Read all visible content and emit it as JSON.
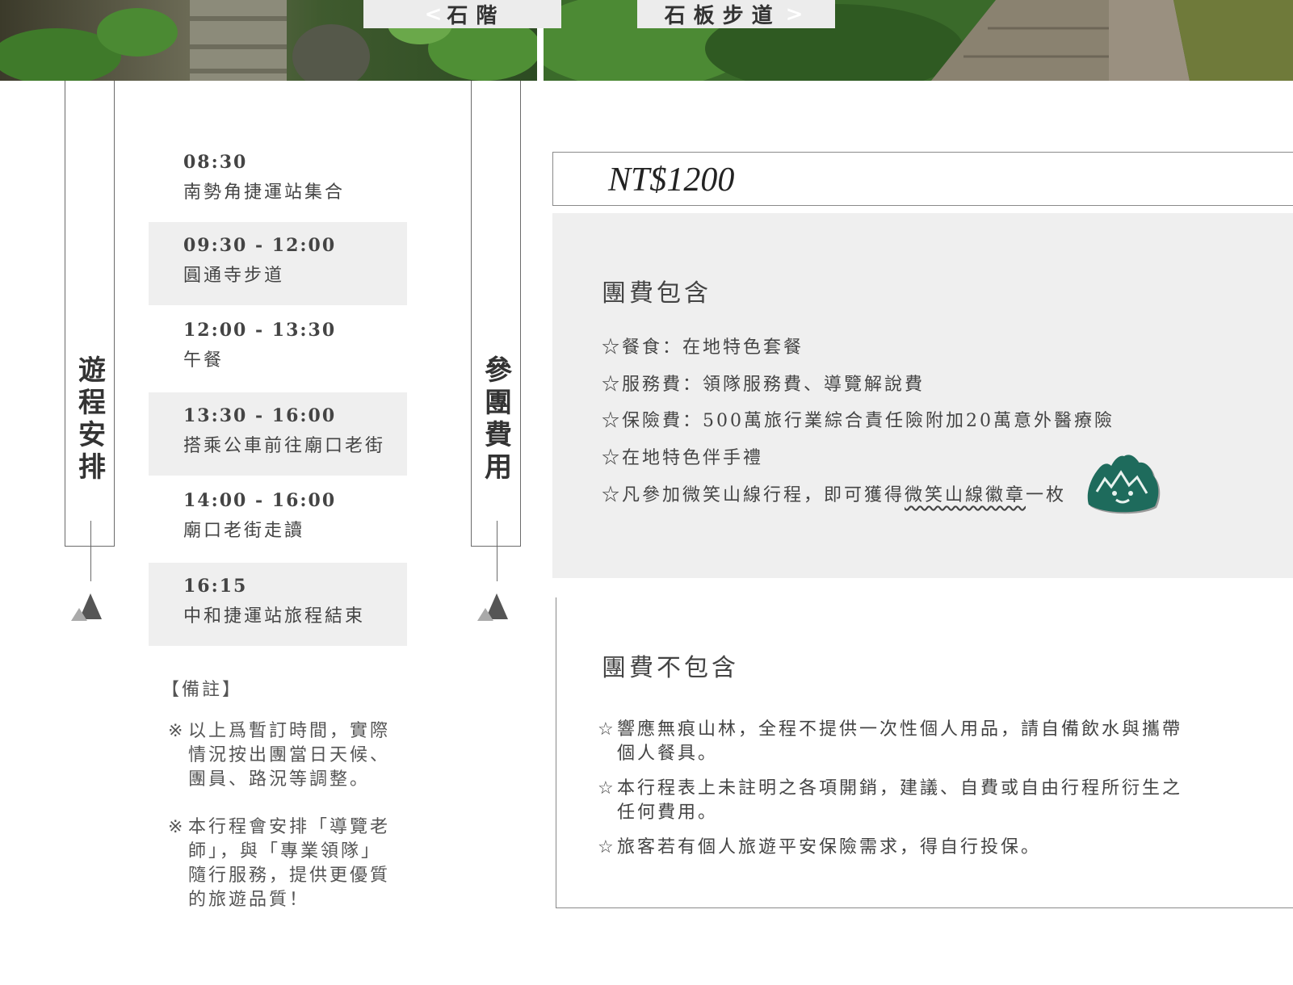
{
  "photos": {
    "left_tab_arrow": "<",
    "left_tab_label": "石階",
    "right_tab_label": "石板步道",
    "right_tab_arrow": ">"
  },
  "itinerary": {
    "label": "遊程安排",
    "items": [
      {
        "time": "08:30",
        "desc": "南勢角捷運站集合"
      },
      {
        "time": "09:30 - 12:00",
        "desc": "圓通寺步道"
      },
      {
        "time": "12:00 - 13:30",
        "desc": "午餐"
      },
      {
        "time": "13:30 - 16:00",
        "desc": "搭乘公車前往廟口老街"
      },
      {
        "time": "14:00 - 16:00",
        "desc": "廟口老街走讀"
      },
      {
        "time": "16:15",
        "desc": "中和捷運站旅程結束"
      }
    ],
    "notes_title": "【備註】",
    "notes": [
      {
        "mark": "※",
        "text": "以上爲暫訂時間，實際情況按出團當日天候、團員、路況等調整。"
      },
      {
        "mark": "※",
        "text": "本行程會安排「導覽老師」，與「專業領隊」隨行服務，提供更優質的旅遊品質！"
      }
    ]
  },
  "fee": {
    "label": "參團費用",
    "price": "NT$1200",
    "included_title": "團費包含",
    "included": [
      "☆餐食：在地特色套餐",
      "☆服務費：領隊服務費、導覽解說費",
      "☆保險費：500萬旅行業綜合責任險附加20萬意外醫療險",
      "☆在地特色伴手禮"
    ],
    "included_last_prefix": "☆凡參加微笑山線行程，即可獲得",
    "included_last_highlight": "微笑山線徽章",
    "included_last_suffix": "一枚",
    "excluded_title": "團費不包含",
    "excluded": [
      {
        "mark": "☆",
        "text": "響應無痕山林，全程不提供一次性個人用品，請自備飲水與攜帶個人餐具。"
      },
      {
        "mark": "☆",
        "text": "本行程表上未註明之各項開銷，建議、自費或自由行程所衍生之任何費用。"
      },
      {
        "mark": "☆",
        "text": "旅客若有個人旅遊平安保險需求，得自行投保。"
      }
    ]
  },
  "colors": {
    "panel": "#efefef",
    "badge": "#1e6b5c",
    "line": "#6b6b6b"
  }
}
